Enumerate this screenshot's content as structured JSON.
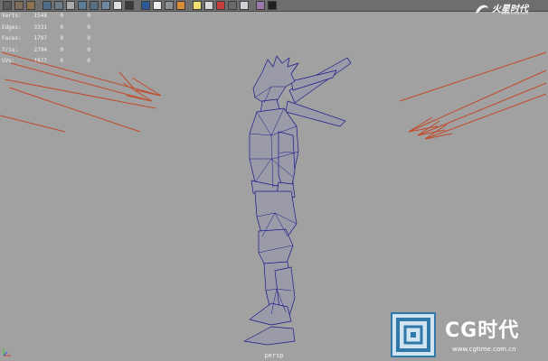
{
  "shelf": {
    "buttons": [
      {
        "icon": "select-tool-icon",
        "color": "#5a5a5a"
      },
      {
        "icon": "lasso-tool-icon",
        "color": "#7c6e5a"
      },
      {
        "icon": "paint-tool-icon",
        "color": "#8e7350"
      },
      {
        "icon": "mesh-tool-icon",
        "color": "#4e6e8a",
        "gap": true
      },
      {
        "icon": "poly-cube-icon",
        "color": "#6b7d8b"
      },
      {
        "icon": "poly-plane-icon",
        "color": "#aaaaaa"
      },
      {
        "icon": "poly-sphere-icon",
        "color": "#5b7b9a"
      },
      {
        "icon": "extrude-icon",
        "color": "#5a6e82"
      },
      {
        "icon": "bevel-icon",
        "color": "#6e86a0"
      },
      {
        "icon": "merge-icon",
        "color": "#e0e0e0"
      },
      {
        "icon": "split-icon",
        "color": "#3a3a3a"
      },
      {
        "icon": "cut-icon",
        "color": "#2a5a9a",
        "gap": true
      },
      {
        "icon": "smooth-icon",
        "color": "#eeeeee"
      },
      {
        "icon": "mirror-icon",
        "color": "#8e9098"
      },
      {
        "icon": "uv-editor-icon",
        "color": "#d88c3c"
      },
      {
        "icon": "light-bulb-icon",
        "color": "#f0e070",
        "gap": true
      },
      {
        "icon": "camera-icon",
        "color": "#d8d8d8"
      },
      {
        "icon": "render-icon",
        "color": "#c83c3c"
      },
      {
        "icon": "shader-icon",
        "color": "#6a6a6a"
      },
      {
        "icon": "hypershade-icon",
        "color": "#d0d0d8"
      },
      {
        "icon": "graph-icon",
        "color": "#9a7aa8",
        "gap": true
      },
      {
        "icon": "script-icon",
        "color": "#202020"
      }
    ]
  },
  "hud": {
    "rows": [
      {
        "label": "Verts:",
        "v1": "1548",
        "v2": "0",
        "v3": "0"
      },
      {
        "label": "Edges:",
        "v1": "3331",
        "v2": "0",
        "v3": "0"
      },
      {
        "label": "Faces:",
        "v1": "1797",
        "v2": "0",
        "v3": "0"
      },
      {
        "label": "Tris:",
        "v1": "2794",
        "v2": "0",
        "v3": "0"
      },
      {
        "label": "UVs:",
        "v1": "1877",
        "v2": "0",
        "v3": "0"
      }
    ]
  },
  "viewport": {
    "camera_label": "persp",
    "background_color": "#a1a1a1",
    "wire_color": "#1a1a8a",
    "mesh_color": "#9a9aa8",
    "light_color": "#c24a2a"
  },
  "watermark": {
    "top_text": "火星时代",
    "top_url": "www.hxsd.com",
    "logo_text": "CG时代",
    "logo_url": "www.cgtime.com.cn"
  }
}
